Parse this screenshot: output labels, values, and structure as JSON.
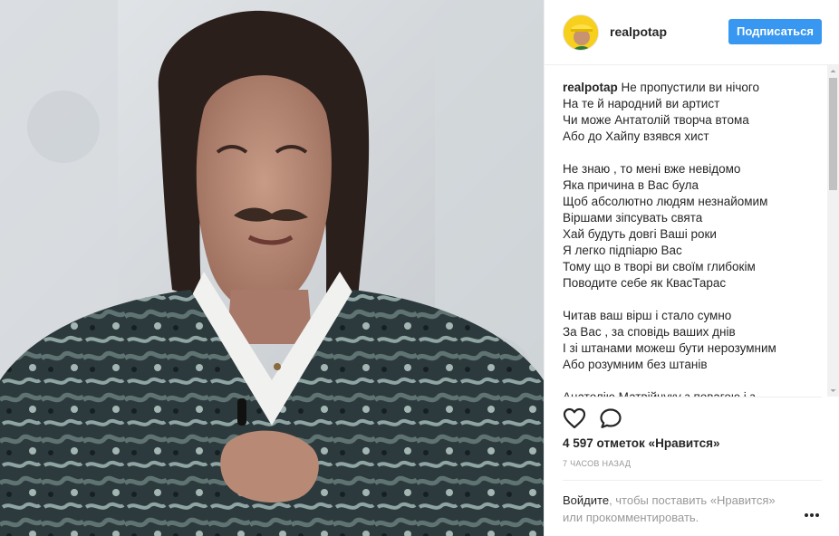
{
  "post": {
    "username": "realpotap",
    "follow_label": "Подписаться"
  },
  "caption": {
    "username": "realpotap",
    "first_line": "Не пропустили ви нічого",
    "lines": [
      "На те й народний ви артист",
      "Чи може Антатолій творча втома",
      "Або до Хайпу взявся хист",
      "",
      "Не знаю , то мені вже невідомо",
      "Яка причина в Вас була",
      "Щоб абсолютно людям незнайомим",
      "Віршами зіпсувать свята",
      "Хай будуть довгі Ваші роки",
      "Я легко підпіарю Вас",
      "Тому що в творі ви своїм глибокім",
      "Поводите себе як КвасТарас",
      "",
      "Читав ваш вірш і стало сумно",
      "За Вас , за сповідь ваших днів",
      "І зі штанами можеш бути нерозумним",
      "Або розумним без штанів",
      "",
      "Анатолію Матвійчуку з повагою і з"
    ]
  },
  "likes": "4 597 отметок «Нравится»",
  "timestamp": "7 часов назад",
  "login": {
    "link_text": "Войдите",
    "rest_text": ", чтобы поставить «Нравится» или прокомментировать."
  },
  "icons": {
    "like": "heart-outline-icon",
    "comment": "comment-bubble-icon",
    "more": "more-horizontal-icon"
  },
  "colors": {
    "follow_button": "#3897f0",
    "text": "#262626",
    "muted": "#999999"
  }
}
